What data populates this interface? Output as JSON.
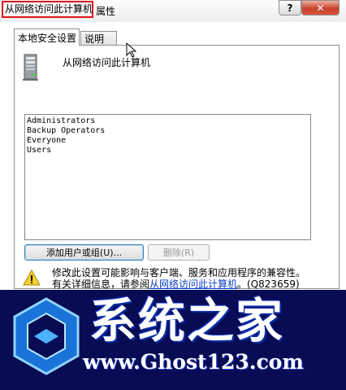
{
  "window": {
    "title": "从网络访问此计算机",
    "title_suffix": "属性",
    "help_label": "?",
    "close_label": "✕"
  },
  "tabs": [
    {
      "label": "本地安全设置",
      "active": true
    },
    {
      "label": "说明",
      "active": false
    }
  ],
  "policy": {
    "title": "从网络访问此计算机",
    "icon": "server-icon"
  },
  "users": [
    "Administrators",
    "Backup Operators",
    "Everyone",
    "Users"
  ],
  "buttons": {
    "add_label": "添加用户或组(U)...",
    "remove_label": "删除(R)"
  },
  "warning": {
    "icon": "warning-icon",
    "line1": "修改此设置可能影响与客户端、服务和应用程序的兼容性。",
    "line2_prefix": "有关详细信息，请参阅",
    "link": "从网络访问此计算机",
    "line2_suffix": "。(Q823659)"
  },
  "watermark": {
    "brand": "系统之家",
    "url": "www.Ghost123.com",
    "colors": {
      "background": "#070c55",
      "text": "#ffffff",
      "logo": "#1a73d9"
    }
  }
}
